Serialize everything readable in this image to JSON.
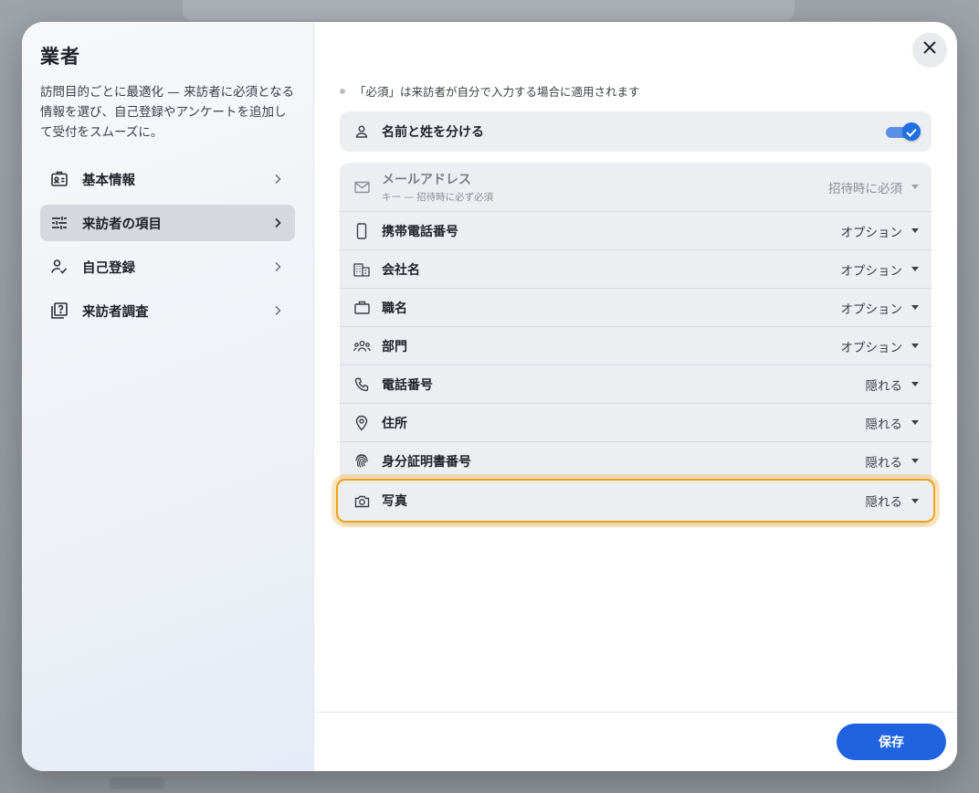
{
  "modal": {
    "title": "業者",
    "description": "訪問目的ごとに最適化 — 来訪者に必須となる情報を選び、自己登録やアンケートを追加して受付をスムーズに。"
  },
  "nav": [
    {
      "label": "基本情報",
      "icon": "id-card-icon",
      "active": false
    },
    {
      "label": "来訪者の項目",
      "icon": "sliders-icon",
      "active": true
    },
    {
      "label": "自己登録",
      "icon": "person-check-icon",
      "active": false
    },
    {
      "label": "来訪者調査",
      "icon": "survey-icon",
      "active": false
    }
  ],
  "note": "「必須」は来訪者が自分で入力する場合に適用されます",
  "split_name": {
    "label": "名前と姓を分ける",
    "enabled": true
  },
  "fields": [
    {
      "label": "メールアドレス",
      "sub": "キー — 招待時に必ず必須",
      "value": "招待時に必須",
      "icon": "mail-icon",
      "disabled": true
    },
    {
      "label": "携帯電話番号",
      "value": "オプション",
      "icon": "mobile-icon"
    },
    {
      "label": "会社名",
      "value": "オプション",
      "icon": "building-icon"
    },
    {
      "label": "職名",
      "value": "オプション",
      "icon": "briefcase-icon"
    },
    {
      "label": "部門",
      "value": "オプション",
      "icon": "group-icon"
    },
    {
      "label": "電話番号",
      "value": "隠れる",
      "icon": "phone-icon"
    },
    {
      "label": "住所",
      "value": "隠れる",
      "icon": "location-pin-icon"
    },
    {
      "label": "身分証明書番号",
      "value": "隠れる",
      "icon": "fingerprint-icon"
    },
    {
      "label": "写真",
      "value": "隠れる",
      "icon": "camera-icon",
      "highlighted": true
    }
  ],
  "footer": {
    "save_label": "保存"
  },
  "colors": {
    "accent": "#1f63e0",
    "highlight": "#f0a21a",
    "toggle": "#1f6fe5"
  }
}
